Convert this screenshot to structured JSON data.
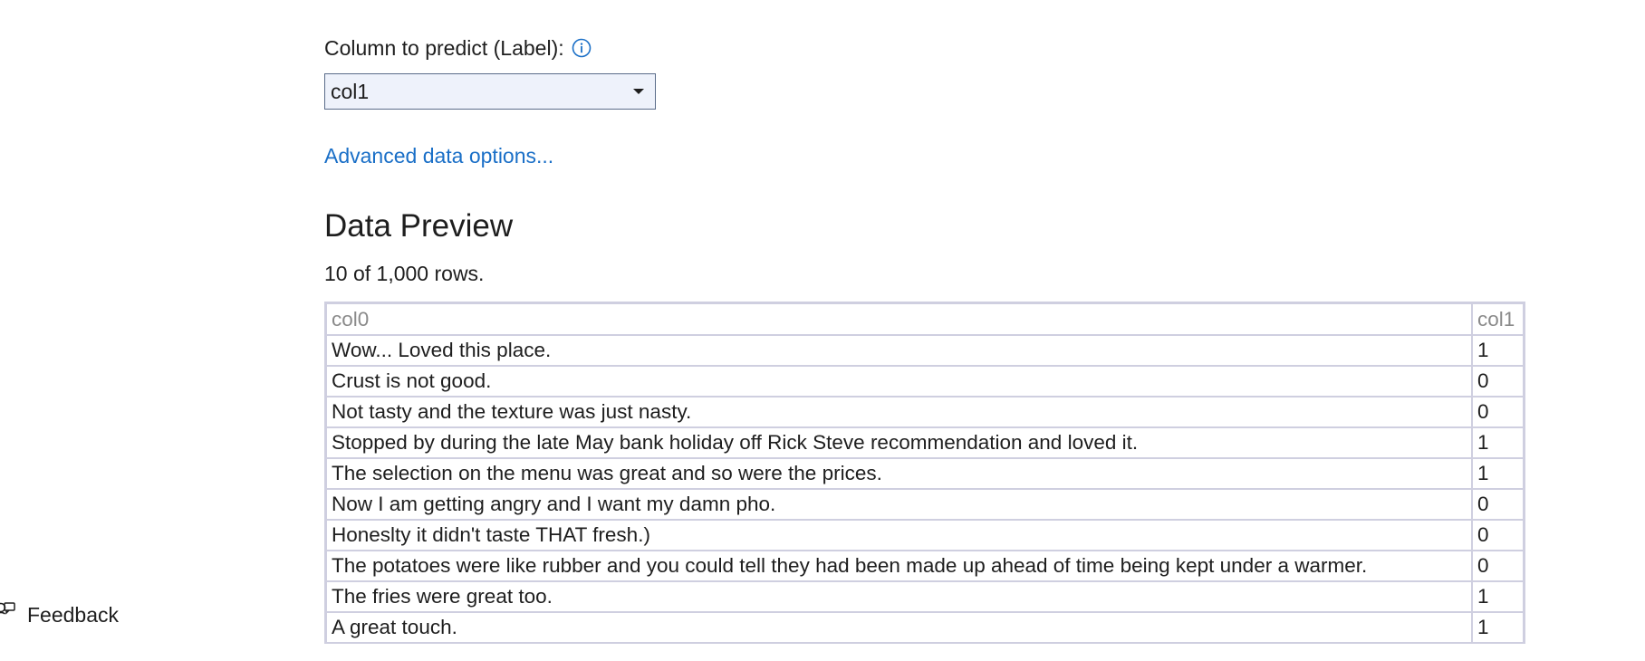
{
  "label_selector": {
    "label": "Column to predict (Label):",
    "info_icon": "info-circle-icon",
    "selected_value": "col1"
  },
  "advanced_link": "Advanced data options...",
  "data_preview": {
    "title": "Data Preview",
    "row_count_text": "10 of 1,000 rows.",
    "columns": [
      "col0",
      "col1"
    ],
    "rows": [
      [
        "Wow... Loved this place.",
        "1"
      ],
      [
        "Crust is not good.",
        "0"
      ],
      [
        "Not tasty and the texture was just nasty.",
        "0"
      ],
      [
        "Stopped by during the late May bank holiday off Rick Steve recommendation and loved it.",
        "1"
      ],
      [
        "The selection on the menu was great and so were the prices.",
        "1"
      ],
      [
        "Now I am getting angry and I want my damn pho.",
        "0"
      ],
      [
        "Honeslty it didn't taste THAT fresh.)",
        "0"
      ],
      [
        "The potatoes were like rubber and you could tell they had been made up ahead of time being kept under a warmer.",
        "0"
      ],
      [
        "The fries were great too.",
        "1"
      ],
      [
        "A great touch.",
        "1"
      ]
    ]
  },
  "feedback": {
    "label": "Feedback",
    "icon": "feedback-person-icon"
  },
  "colors": {
    "link": "#1a6fc7",
    "select_bg": "#eef2fb",
    "select_border": "#5a6c8a",
    "table_border": "#cfcfe0",
    "header_text": "#8a8a8a"
  }
}
